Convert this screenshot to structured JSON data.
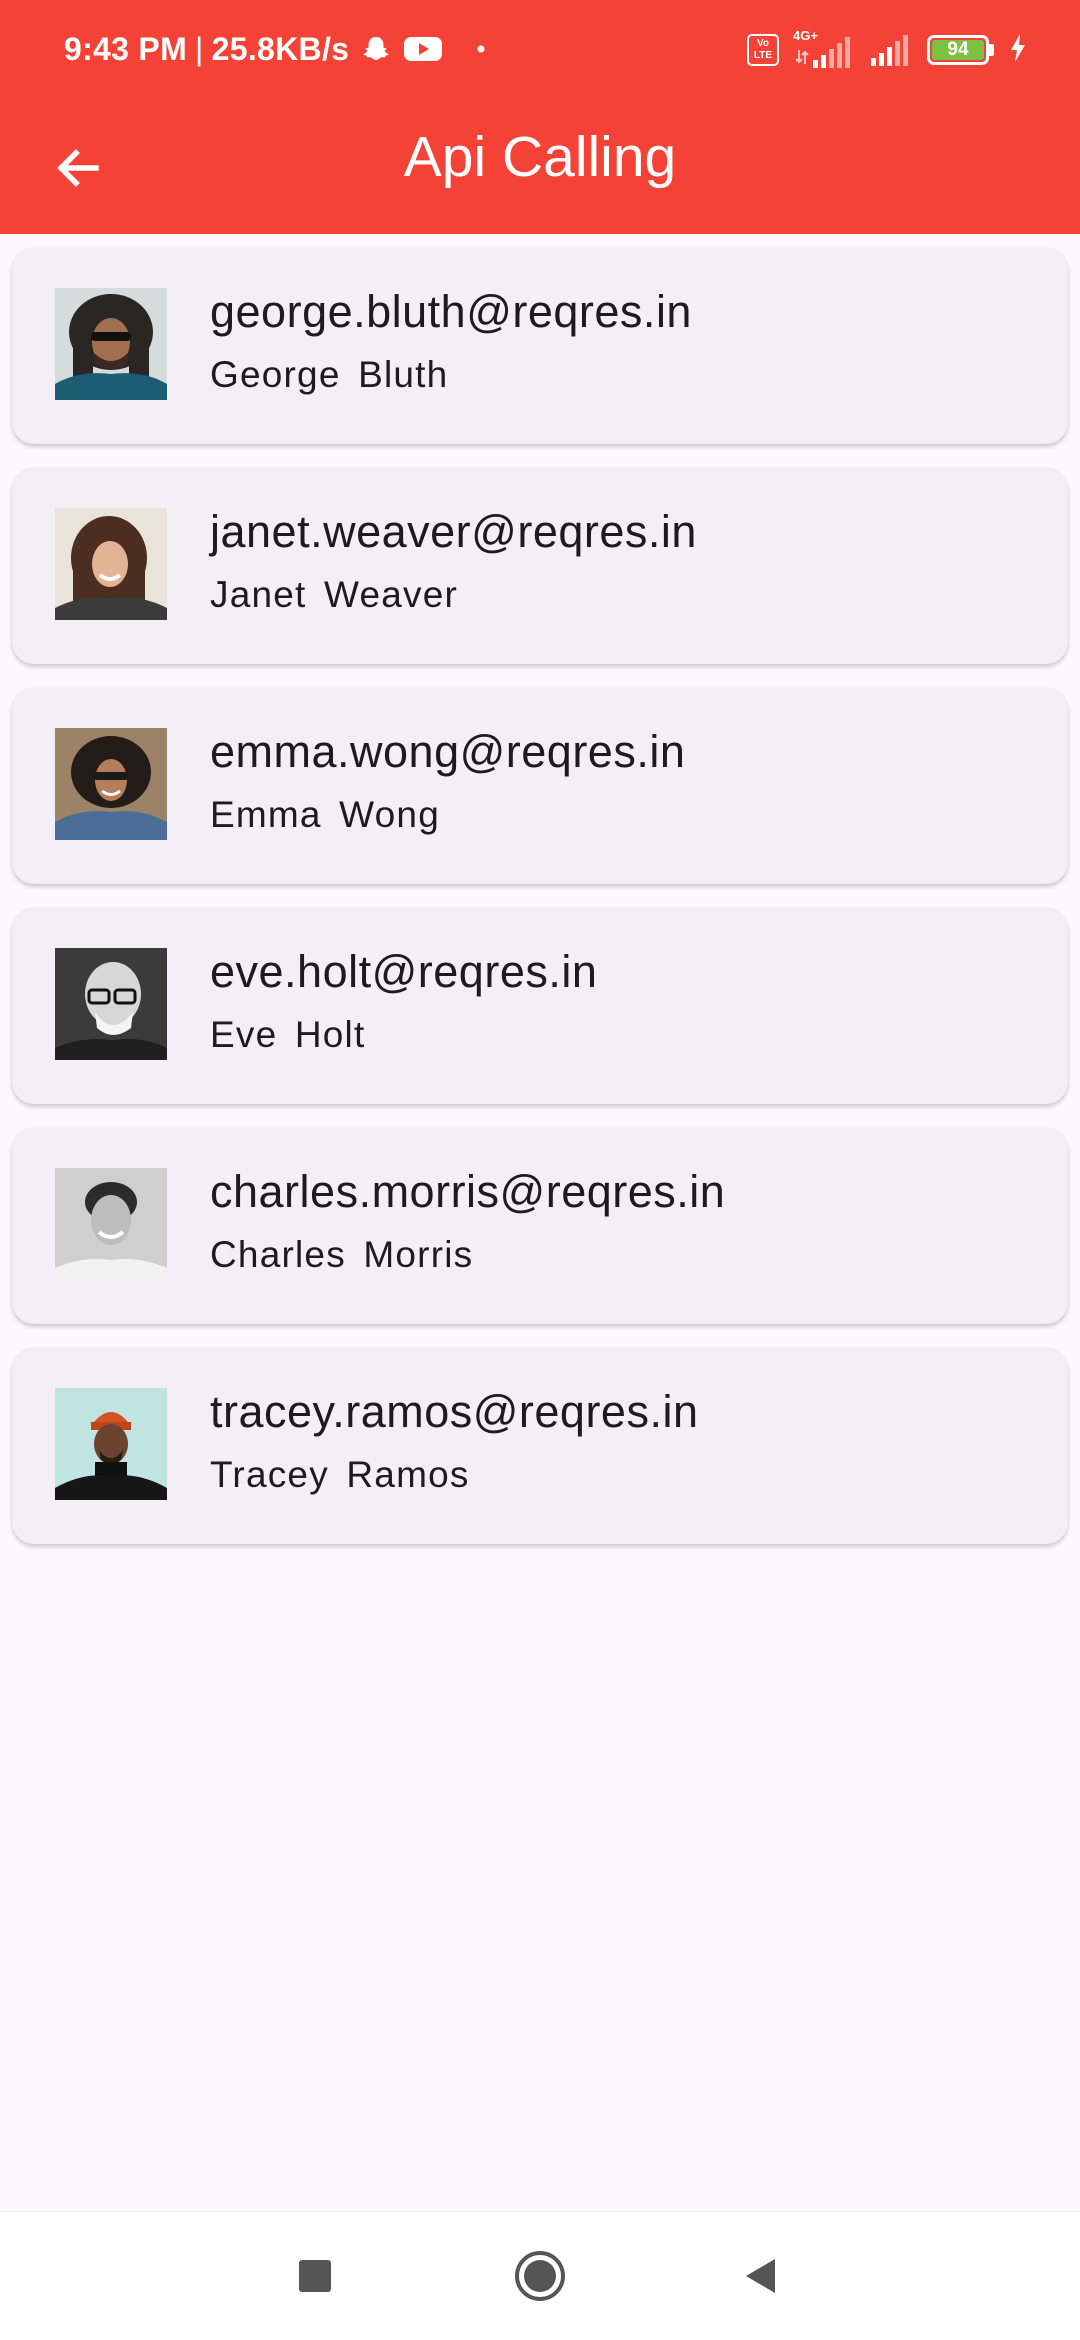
{
  "status_bar": {
    "time": "9:43 PM",
    "separator": "|",
    "network_speed": "25.8KB/s",
    "notification_icons": [
      "snapchat-icon",
      "youtube-icon",
      "dot-icon"
    ],
    "volte_label_top": "Vo",
    "volte_label_bottom": "LTE",
    "network_type": "4G+",
    "battery_level": "94",
    "charging": true
  },
  "app_bar": {
    "title": "Api Calling",
    "back_icon": "arrow-left-icon",
    "background": "#f44336"
  },
  "users": [
    {
      "email": "george.bluth@reqres.in",
      "name": "George Bluth"
    },
    {
      "email": "janet.weaver@reqres.in",
      "name": "Janet Weaver"
    },
    {
      "email": "emma.wong@reqres.in",
      "name": "Emma Wong"
    },
    {
      "email": "eve.holt@reqres.in",
      "name": "Eve Holt"
    },
    {
      "email": "charles.morris@reqres.in",
      "name": "Charles Morris"
    },
    {
      "email": "tracey.ramos@reqres.in",
      "name": "Tracey Ramos"
    }
  ],
  "nav_bar": {
    "buttons": [
      "recents-square-icon",
      "home-circle-icon",
      "back-triangle-icon"
    ]
  },
  "colors": {
    "accent": "#f44336",
    "card_background": "#f3eff6",
    "page_background": "#fdf8fc",
    "text": "#1c1b1f"
  }
}
